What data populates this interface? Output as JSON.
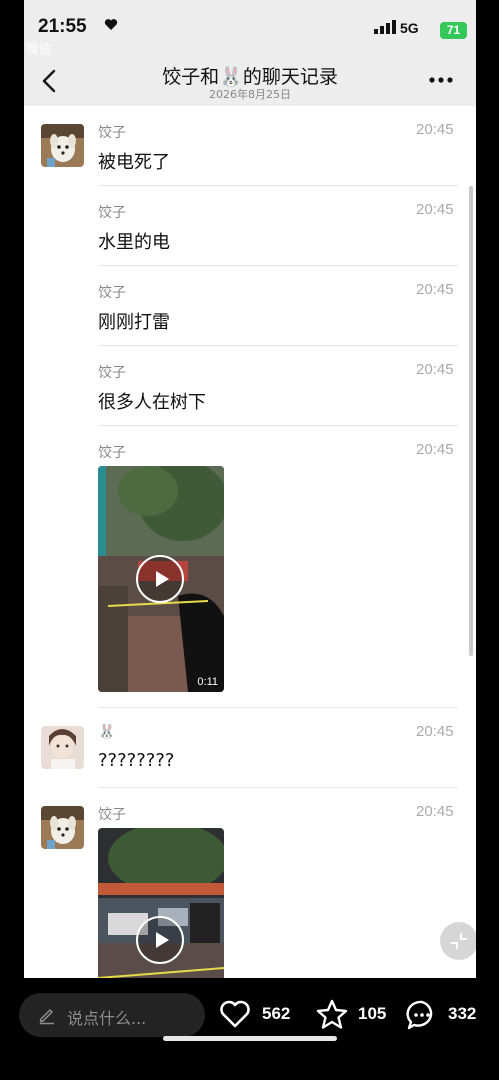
{
  "status_bar": {
    "time": "21:55",
    "back_app": "微信",
    "network": "5G",
    "battery": "71"
  },
  "nav": {
    "title": "饺子和🐰的聊天记录",
    "subtitle": "2026年8月25日"
  },
  "messages": [
    {
      "sender": "饺子",
      "time": "20:45",
      "text": "被电死了"
    },
    {
      "sender": "饺子",
      "time": "20:45",
      "text": "水里的电"
    },
    {
      "sender": "饺子",
      "time": "20:45",
      "text": "刚刚打雷"
    },
    {
      "sender": "饺子",
      "time": "20:45",
      "text": "很多人在树下"
    },
    {
      "sender": "饺子",
      "time": "20:45",
      "video_duration": "0:11"
    },
    {
      "sender": "🐰",
      "time": "20:45",
      "text": "????????"
    },
    {
      "sender": "饺子",
      "time": "20:45"
    }
  ],
  "bottom_bar": {
    "input_placeholder": "说点什么...",
    "likes": "562",
    "favorites": "105",
    "comments": "332"
  },
  "icons": [
    "back-icon",
    "more-icon",
    "play-icon",
    "collapse-icon",
    "pencil-icon",
    "heart-icon",
    "star-icon",
    "comment-icon"
  ]
}
